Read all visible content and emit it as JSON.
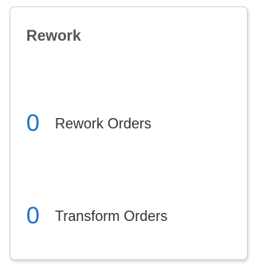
{
  "card": {
    "title": "Rework",
    "items": [
      {
        "count": "0",
        "label": "Rework Orders"
      },
      {
        "count": "0",
        "label": "Transform Orders"
      }
    ]
  },
  "colors": {
    "count": "#1a73c8",
    "title": "#555555",
    "label": "#333333",
    "border": "#d4d4d4"
  }
}
